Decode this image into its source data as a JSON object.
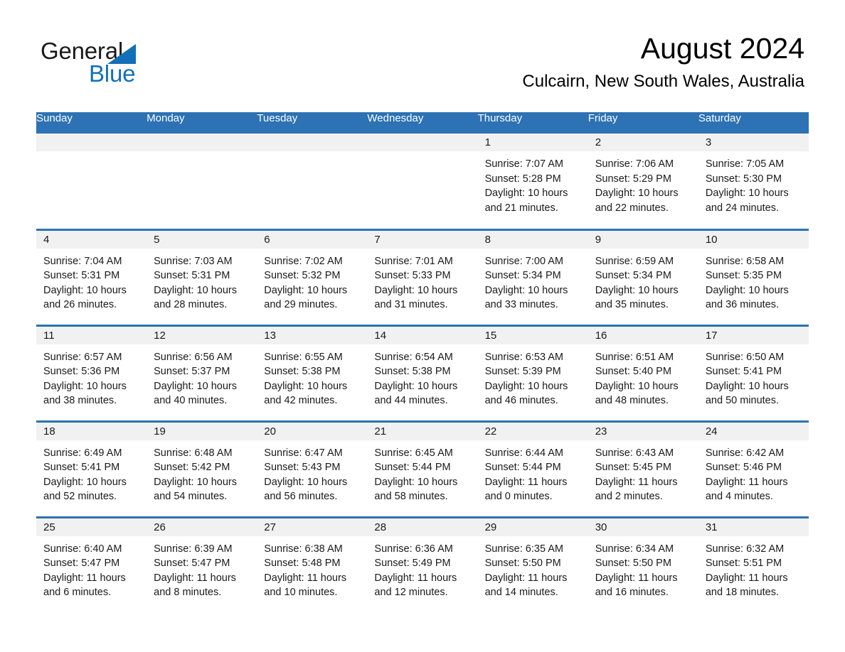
{
  "logo": {
    "word_one": "General",
    "word_two": "Blue",
    "triangle_color": "#1270b8",
    "text_color": "#1a1a1a"
  },
  "header": {
    "title": "August 2024",
    "subtitle": "Culcairn, New South Wales, Australia",
    "accent_color": "#2c72b4",
    "band_color": "#f1f1f1"
  },
  "calendar": {
    "weekday_headers": [
      "Sunday",
      "Monday",
      "Tuesday",
      "Wednesday",
      "Thursday",
      "Friday",
      "Saturday"
    ],
    "weeks": [
      [
        {
          "day": "",
          "sunrise": "",
          "sunset": "",
          "daylight_line1": "",
          "daylight_line2": ""
        },
        {
          "day": "",
          "sunrise": "",
          "sunset": "",
          "daylight_line1": "",
          "daylight_line2": ""
        },
        {
          "day": "",
          "sunrise": "",
          "sunset": "",
          "daylight_line1": "",
          "daylight_line2": ""
        },
        {
          "day": "",
          "sunrise": "",
          "sunset": "",
          "daylight_line1": "",
          "daylight_line2": ""
        },
        {
          "day": "1",
          "sunrise": "Sunrise: 7:07 AM",
          "sunset": "Sunset: 5:28 PM",
          "daylight_line1": "Daylight: 10 hours",
          "daylight_line2": "and 21 minutes."
        },
        {
          "day": "2",
          "sunrise": "Sunrise: 7:06 AM",
          "sunset": "Sunset: 5:29 PM",
          "daylight_line1": "Daylight: 10 hours",
          "daylight_line2": "and 22 minutes."
        },
        {
          "day": "3",
          "sunrise": "Sunrise: 7:05 AM",
          "sunset": "Sunset: 5:30 PM",
          "daylight_line1": "Daylight: 10 hours",
          "daylight_line2": "and 24 minutes."
        }
      ],
      [
        {
          "day": "4",
          "sunrise": "Sunrise: 7:04 AM",
          "sunset": "Sunset: 5:31 PM",
          "daylight_line1": "Daylight: 10 hours",
          "daylight_line2": "and 26 minutes."
        },
        {
          "day": "5",
          "sunrise": "Sunrise: 7:03 AM",
          "sunset": "Sunset: 5:31 PM",
          "daylight_line1": "Daylight: 10 hours",
          "daylight_line2": "and 28 minutes."
        },
        {
          "day": "6",
          "sunrise": "Sunrise: 7:02 AM",
          "sunset": "Sunset: 5:32 PM",
          "daylight_line1": "Daylight: 10 hours",
          "daylight_line2": "and 29 minutes."
        },
        {
          "day": "7",
          "sunrise": "Sunrise: 7:01 AM",
          "sunset": "Sunset: 5:33 PM",
          "daylight_line1": "Daylight: 10 hours",
          "daylight_line2": "and 31 minutes."
        },
        {
          "day": "8",
          "sunrise": "Sunrise: 7:00 AM",
          "sunset": "Sunset: 5:34 PM",
          "daylight_line1": "Daylight: 10 hours",
          "daylight_line2": "and 33 minutes."
        },
        {
          "day": "9",
          "sunrise": "Sunrise: 6:59 AM",
          "sunset": "Sunset: 5:34 PM",
          "daylight_line1": "Daylight: 10 hours",
          "daylight_line2": "and 35 minutes."
        },
        {
          "day": "10",
          "sunrise": "Sunrise: 6:58 AM",
          "sunset": "Sunset: 5:35 PM",
          "daylight_line1": "Daylight: 10 hours",
          "daylight_line2": "and 36 minutes."
        }
      ],
      [
        {
          "day": "11",
          "sunrise": "Sunrise: 6:57 AM",
          "sunset": "Sunset: 5:36 PM",
          "daylight_line1": "Daylight: 10 hours",
          "daylight_line2": "and 38 minutes."
        },
        {
          "day": "12",
          "sunrise": "Sunrise: 6:56 AM",
          "sunset": "Sunset: 5:37 PM",
          "daylight_line1": "Daylight: 10 hours",
          "daylight_line2": "and 40 minutes."
        },
        {
          "day": "13",
          "sunrise": "Sunrise: 6:55 AM",
          "sunset": "Sunset: 5:38 PM",
          "daylight_line1": "Daylight: 10 hours",
          "daylight_line2": "and 42 minutes."
        },
        {
          "day": "14",
          "sunrise": "Sunrise: 6:54 AM",
          "sunset": "Sunset: 5:38 PM",
          "daylight_line1": "Daylight: 10 hours",
          "daylight_line2": "and 44 minutes."
        },
        {
          "day": "15",
          "sunrise": "Sunrise: 6:53 AM",
          "sunset": "Sunset: 5:39 PM",
          "daylight_line1": "Daylight: 10 hours",
          "daylight_line2": "and 46 minutes."
        },
        {
          "day": "16",
          "sunrise": "Sunrise: 6:51 AM",
          "sunset": "Sunset: 5:40 PM",
          "daylight_line1": "Daylight: 10 hours",
          "daylight_line2": "and 48 minutes."
        },
        {
          "day": "17",
          "sunrise": "Sunrise: 6:50 AM",
          "sunset": "Sunset: 5:41 PM",
          "daylight_line1": "Daylight: 10 hours",
          "daylight_line2": "and 50 minutes."
        }
      ],
      [
        {
          "day": "18",
          "sunrise": "Sunrise: 6:49 AM",
          "sunset": "Sunset: 5:41 PM",
          "daylight_line1": "Daylight: 10 hours",
          "daylight_line2": "and 52 minutes."
        },
        {
          "day": "19",
          "sunrise": "Sunrise: 6:48 AM",
          "sunset": "Sunset: 5:42 PM",
          "daylight_line1": "Daylight: 10 hours",
          "daylight_line2": "and 54 minutes."
        },
        {
          "day": "20",
          "sunrise": "Sunrise: 6:47 AM",
          "sunset": "Sunset: 5:43 PM",
          "daylight_line1": "Daylight: 10 hours",
          "daylight_line2": "and 56 minutes."
        },
        {
          "day": "21",
          "sunrise": "Sunrise: 6:45 AM",
          "sunset": "Sunset: 5:44 PM",
          "daylight_line1": "Daylight: 10 hours",
          "daylight_line2": "and 58 minutes."
        },
        {
          "day": "22",
          "sunrise": "Sunrise: 6:44 AM",
          "sunset": "Sunset: 5:44 PM",
          "daylight_line1": "Daylight: 11 hours",
          "daylight_line2": "and 0 minutes."
        },
        {
          "day": "23",
          "sunrise": "Sunrise: 6:43 AM",
          "sunset": "Sunset: 5:45 PM",
          "daylight_line1": "Daylight: 11 hours",
          "daylight_line2": "and 2 minutes."
        },
        {
          "day": "24",
          "sunrise": "Sunrise: 6:42 AM",
          "sunset": "Sunset: 5:46 PM",
          "daylight_line1": "Daylight: 11 hours",
          "daylight_line2": "and 4 minutes."
        }
      ],
      [
        {
          "day": "25",
          "sunrise": "Sunrise: 6:40 AM",
          "sunset": "Sunset: 5:47 PM",
          "daylight_line1": "Daylight: 11 hours",
          "daylight_line2": "and 6 minutes."
        },
        {
          "day": "26",
          "sunrise": "Sunrise: 6:39 AM",
          "sunset": "Sunset: 5:47 PM",
          "daylight_line1": "Daylight: 11 hours",
          "daylight_line2": "and 8 minutes."
        },
        {
          "day": "27",
          "sunrise": "Sunrise: 6:38 AM",
          "sunset": "Sunset: 5:48 PM",
          "daylight_line1": "Daylight: 11 hours",
          "daylight_line2": "and 10 minutes."
        },
        {
          "day": "28",
          "sunrise": "Sunrise: 6:36 AM",
          "sunset": "Sunset: 5:49 PM",
          "daylight_line1": "Daylight: 11 hours",
          "daylight_line2": "and 12 minutes."
        },
        {
          "day": "29",
          "sunrise": "Sunrise: 6:35 AM",
          "sunset": "Sunset: 5:50 PM",
          "daylight_line1": "Daylight: 11 hours",
          "daylight_line2": "and 14 minutes."
        },
        {
          "day": "30",
          "sunrise": "Sunrise: 6:34 AM",
          "sunset": "Sunset: 5:50 PM",
          "daylight_line1": "Daylight: 11 hours",
          "daylight_line2": "and 16 minutes."
        },
        {
          "day": "31",
          "sunrise": "Sunrise: 6:32 AM",
          "sunset": "Sunset: 5:51 PM",
          "daylight_line1": "Daylight: 11 hours",
          "daylight_line2": "and 18 minutes."
        }
      ]
    ]
  }
}
